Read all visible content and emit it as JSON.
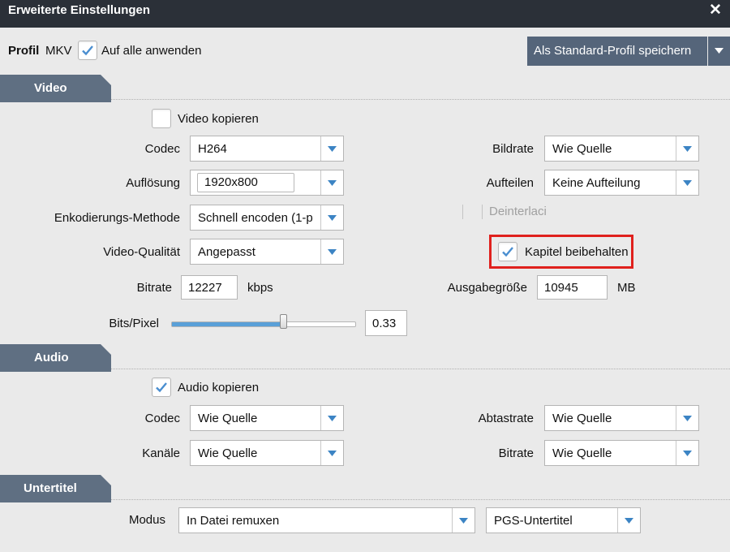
{
  "window": {
    "title": "Erweiterte Einstellungen"
  },
  "profile": {
    "label": "Profil",
    "value": "MKV",
    "apply_all_label": "Auf alle anwenden",
    "apply_all_checked": true,
    "save_button_label": "Als Standard-Profil speichern"
  },
  "video": {
    "section_label": "Video",
    "copy_label": "Video kopieren",
    "copy_checked": false,
    "codec_label": "Codec",
    "codec_value": "H264",
    "resolution_label": "Auflösung",
    "resolution_value": "1920x800",
    "encoding_label": "Enkodierungs-Methode",
    "encoding_value": "Schnell encoden (1-p",
    "quality_label": "Video-Qualität",
    "quality_value": "Angepasst",
    "bitrate_label": "Bitrate",
    "bitrate_value": "12227",
    "bitrate_unit": "kbps",
    "bits_pixel_label": "Bits/Pixel",
    "bits_pixel_value": "0.33",
    "bits_pixel_fraction": 0.61,
    "framerate_label": "Bildrate",
    "framerate_value": "Wie Quelle",
    "split_label": "Aufteilen",
    "split_value": "Keine Aufteilung",
    "deinterlace_label": "Deinterlaci",
    "chapters_label": "Kapitel beibehalten",
    "chapters_checked": true,
    "output_size_label": "Ausgabegröße",
    "output_size_value": "10945",
    "output_size_unit": "MB"
  },
  "audio": {
    "section_label": "Audio",
    "copy_label": "Audio kopieren",
    "copy_checked": true,
    "codec_label": "Codec",
    "codec_value": "Wie Quelle",
    "channels_label": "Kanäle",
    "channels_value": "Wie Quelle",
    "samplerate_label": "Abtastrate",
    "samplerate_value": "Wie Quelle",
    "bitrate_label": "Bitrate",
    "bitrate_value": "Wie Quelle"
  },
  "subtitles": {
    "section_label": "Untertitel",
    "mode_label": "Modus",
    "mode_value": "In Datei remuxen",
    "format_value": "PGS-Untertitel"
  },
  "colors": {
    "titlebar": "#2b3038",
    "section": "#5f6f82",
    "button": "#55657a",
    "accent": "#5aa0d8",
    "highlight": "#e0211d"
  },
  "icons": {
    "close": "close-icon",
    "check": "checkmark-icon",
    "dropdown": "chevron-down-icon"
  }
}
